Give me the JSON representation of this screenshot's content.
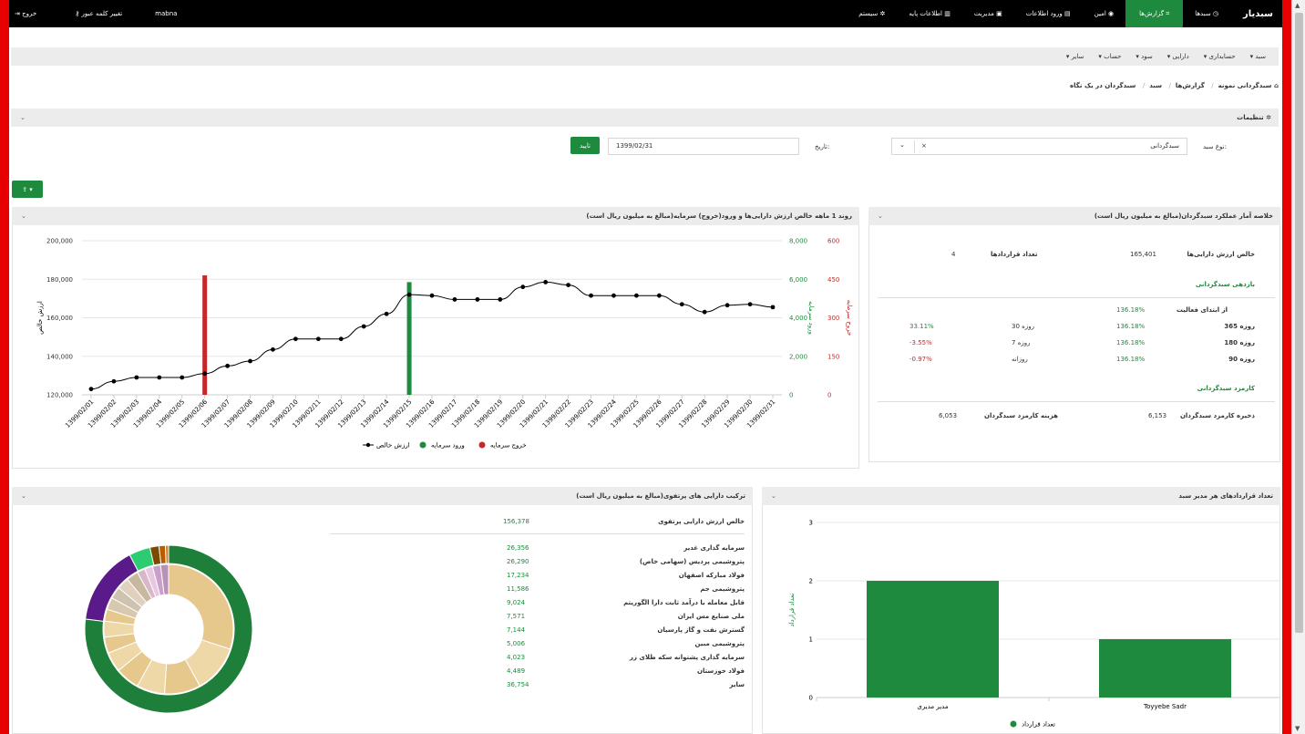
{
  "topnav": {
    "brand": "سبدیار",
    "items": [
      {
        "label": "سبدها",
        "icon": "gauge-icon"
      },
      {
        "label": "گزارش‌ها",
        "icon": "chart-icon",
        "active": true
      },
      {
        "label": "امین",
        "icon": "eye-icon"
      },
      {
        "label": "ورود اطلاعات",
        "icon": "file-icon"
      },
      {
        "label": "مدیریت",
        "icon": "briefcase-icon"
      },
      {
        "label": "اطلاعات پایه",
        "icon": "database-icon"
      },
      {
        "label": "سیستم",
        "icon": "gear-icon"
      }
    ],
    "user": "mabna",
    "change_password": "تغییر کلمه عبور",
    "logout": "خروج"
  },
  "submenu": [
    "سبد",
    "حسابداری",
    "دارایی",
    "سود",
    "حساب",
    "سایر"
  ],
  "breadcrumb": [
    "سبدگردانی نمونه",
    "گزارش‌ها",
    "سبد",
    "سبدگردان در یک نگاه"
  ],
  "settings": {
    "title": "تنظیمات",
    "basket_type_label": "نوع سبد:",
    "basket_type_value": "سبدگردانی",
    "date_label": "تاریخ:",
    "date_value": "1399/02/31",
    "confirm": "تایید"
  },
  "summary": {
    "title": "خلاصه آمار عملکرد سبدگردان(مبالغ به میلیون ریال است)",
    "net_assets_label": "خالص ارزش دارایی‌ها",
    "net_assets_value": "165,401",
    "contracts_label": "تعداد قراردادها",
    "contracts_value": "4",
    "returns_title": "بازدهی سبدگردانی",
    "since_start_label": "از ابتدای فعالیت",
    "since_start_value": "136.18%",
    "rows": [
      {
        "l1": "365 روزه",
        "v1": "136.18%",
        "l2": "30 روزه",
        "v2": "33.11%",
        "c2": "g"
      },
      {
        "l1": "180 روزه",
        "v1": "136.18%",
        "l2": "7 روزه",
        "v2": "-3.55%",
        "c2": "rd"
      },
      {
        "l1": "90 روزه",
        "v1": "136.18%",
        "l2": "روزانه",
        "v2": "-0.97%",
        "c2": "rd"
      }
    ],
    "fee_title": "کارمزد سبدگردانی",
    "fee_reserve_label": "ذخیره کارمزد سبدگردان",
    "fee_reserve_value": "6,153",
    "fee_cost_label": "هزینه کارمزد سبدگردان",
    "fee_cost_value": "6,053"
  },
  "trend": {
    "title": "روند 1 ماهه خالص ارزش دارایی‌ها و ورود(خروج) سرمایه(مبالغ به میلیون ریال است)",
    "legend": [
      "ارزش خالص",
      "ورود سرمایه",
      "خروج سرمایه"
    ]
  },
  "composition": {
    "title": "ترکیب دارایی های پرتفوی(مبالغ به میلیون ریال است)",
    "total_label": "خالص ارزش دارایی پرتفوی",
    "total_value": "156,378",
    "items": [
      {
        "name": "سرمایه گذاری غدیر",
        "value": "26,356"
      },
      {
        "name": "پتروشیمی پردیس (سهامی خاص)",
        "value": "26,290"
      },
      {
        "name": "فولاد مبارکه اصفهان",
        "value": "17,234"
      },
      {
        "name": "پتروشیمی جم",
        "value": "11,586"
      },
      {
        "name": "قابل معامله با درآمد ثابت دارا الگوریتم",
        "value": "9,024"
      },
      {
        "name": "ملی صنایع مس ایران",
        "value": "7,571"
      },
      {
        "name": "گسترش نفت و گاز پارسیان",
        "value": "7,144"
      },
      {
        "name": "پتروشیمی مبین",
        "value": "5,006"
      },
      {
        "name": "سرمایه گذاری پشتوانه سکه طلای زر",
        "value": "4,023"
      },
      {
        "name": "فولاد خوزستان",
        "value": "4,489"
      },
      {
        "name": "سایر",
        "value": "36,754"
      }
    ]
  },
  "contracts_chart": {
    "title": "تعداد قراردادهای هر مدیر سبد",
    "legend": "تعداد قرارداد"
  },
  "chart_data": [
    {
      "type": "line",
      "x": [
        "1399/02/01",
        "1399/02/02",
        "1399/02/03",
        "1399/02/04",
        "1399/02/05",
        "1399/02/06",
        "1399/02/07",
        "1399/02/08",
        "1399/02/09",
        "1399/02/10",
        "1399/02/11",
        "1399/02/12",
        "1399/02/13",
        "1399/02/14",
        "1399/02/15",
        "1399/02/16",
        "1399/02/17",
        "1399/02/18",
        "1399/02/19",
        "1399/02/20",
        "1399/02/21",
        "1399/02/22",
        "1399/02/23",
        "1399/02/24",
        "1399/02/25",
        "1399/02/26",
        "1399/02/27",
        "1399/02/28",
        "1399/02/29",
        "1399/02/30",
        "1399/02/31"
      ],
      "series": [
        {
          "name": "ارزش خالص",
          "axis": "left",
          "values": [
            123000,
            127000,
            129000,
            129000,
            129000,
            131000,
            135000,
            137500,
            143500,
            149000,
            149000,
            149000,
            155500,
            162000,
            172000,
            171500,
            169500,
            169500,
            169500,
            176000,
            178500,
            177000,
            171500,
            171500,
            171500,
            171500,
            167000,
            163000,
            166500,
            167000,
            165500
          ]
        },
        {
          "name": "ورود سرمایه",
          "axis": "right",
          "values": [
            0,
            0,
            0,
            0,
            0,
            0,
            0,
            0,
            0,
            0,
            0,
            0,
            0,
            0,
            5850,
            0,
            0,
            0,
            0,
            0,
            0,
            0,
            0,
            0,
            0,
            0,
            0,
            0,
            0,
            0,
            0
          ]
        },
        {
          "name": "خروج سرمایه",
          "axis": "right2",
          "values": [
            0,
            0,
            0,
            0,
            0,
            465,
            0,
            0,
            0,
            0,
            0,
            0,
            0,
            0,
            0,
            0,
            0,
            0,
            0,
            0,
            0,
            0,
            0,
            0,
            0,
            0,
            0,
            0,
            0,
            0,
            0
          ]
        }
      ],
      "ylabel": "ارزش خالص",
      "y2label": "ورود سرمایه",
      "y3label": "خروج سرمایه",
      "ylim": [
        120000,
        200000
      ],
      "y2lim": [
        0,
        8000
      ],
      "y3lim": [
        0,
        600
      ],
      "yticks": [
        "120,000",
        "140,000",
        "160,000",
        "180,000",
        "200,000"
      ],
      "y2ticks": [
        "0",
        "2,000",
        "4,000",
        "6,000",
        "8,000"
      ],
      "y3ticks": [
        "0",
        "150",
        "300",
        "450",
        "600"
      ]
    },
    {
      "type": "pie",
      "rings": [
        {
          "name": "outer",
          "values": [
            75,
            15,
            4,
            1.7,
            1.2,
            0.6
          ],
          "colors": [
            "#1e7f3a",
            "#5a1a8a",
            "#2ecc71",
            "#7a4a00",
            "#b85c00",
            "#d08030"
          ]
        },
        {
          "name": "inner",
          "values": [
            30,
            12,
            9,
            7,
            6,
            5,
            4,
            4,
            3,
            3,
            3,
            3,
            3,
            2,
            2,
            2,
            2
          ],
          "colors": [
            "#e6c88c",
            "#efd8a8",
            "#e6c88c",
            "#efd8a8",
            "#e6c88c",
            "#efd8a8",
            "#e6c88c",
            "#efd8a8",
            "#e6c88c",
            "#d9c8b0",
            "#cfc3b0",
            "#e0d0c0",
            "#c8b8a0",
            "#d8b8c8",
            "#e8c8e0",
            "#c8a0c8",
            "#b890b8"
          ]
        }
      ]
    },
    {
      "type": "bar",
      "categories": [
        "مدیر مدیری",
        "Toyyebe Sadr"
      ],
      "series": [
        {
          "name": "تعداد قرارداد",
          "values": [
            2,
            1
          ]
        }
      ],
      "ylabel": "تعداد قرارداد",
      "ylim": [
        0,
        3
      ],
      "yticks": [
        "0",
        "1",
        "2",
        "3"
      ]
    }
  ]
}
